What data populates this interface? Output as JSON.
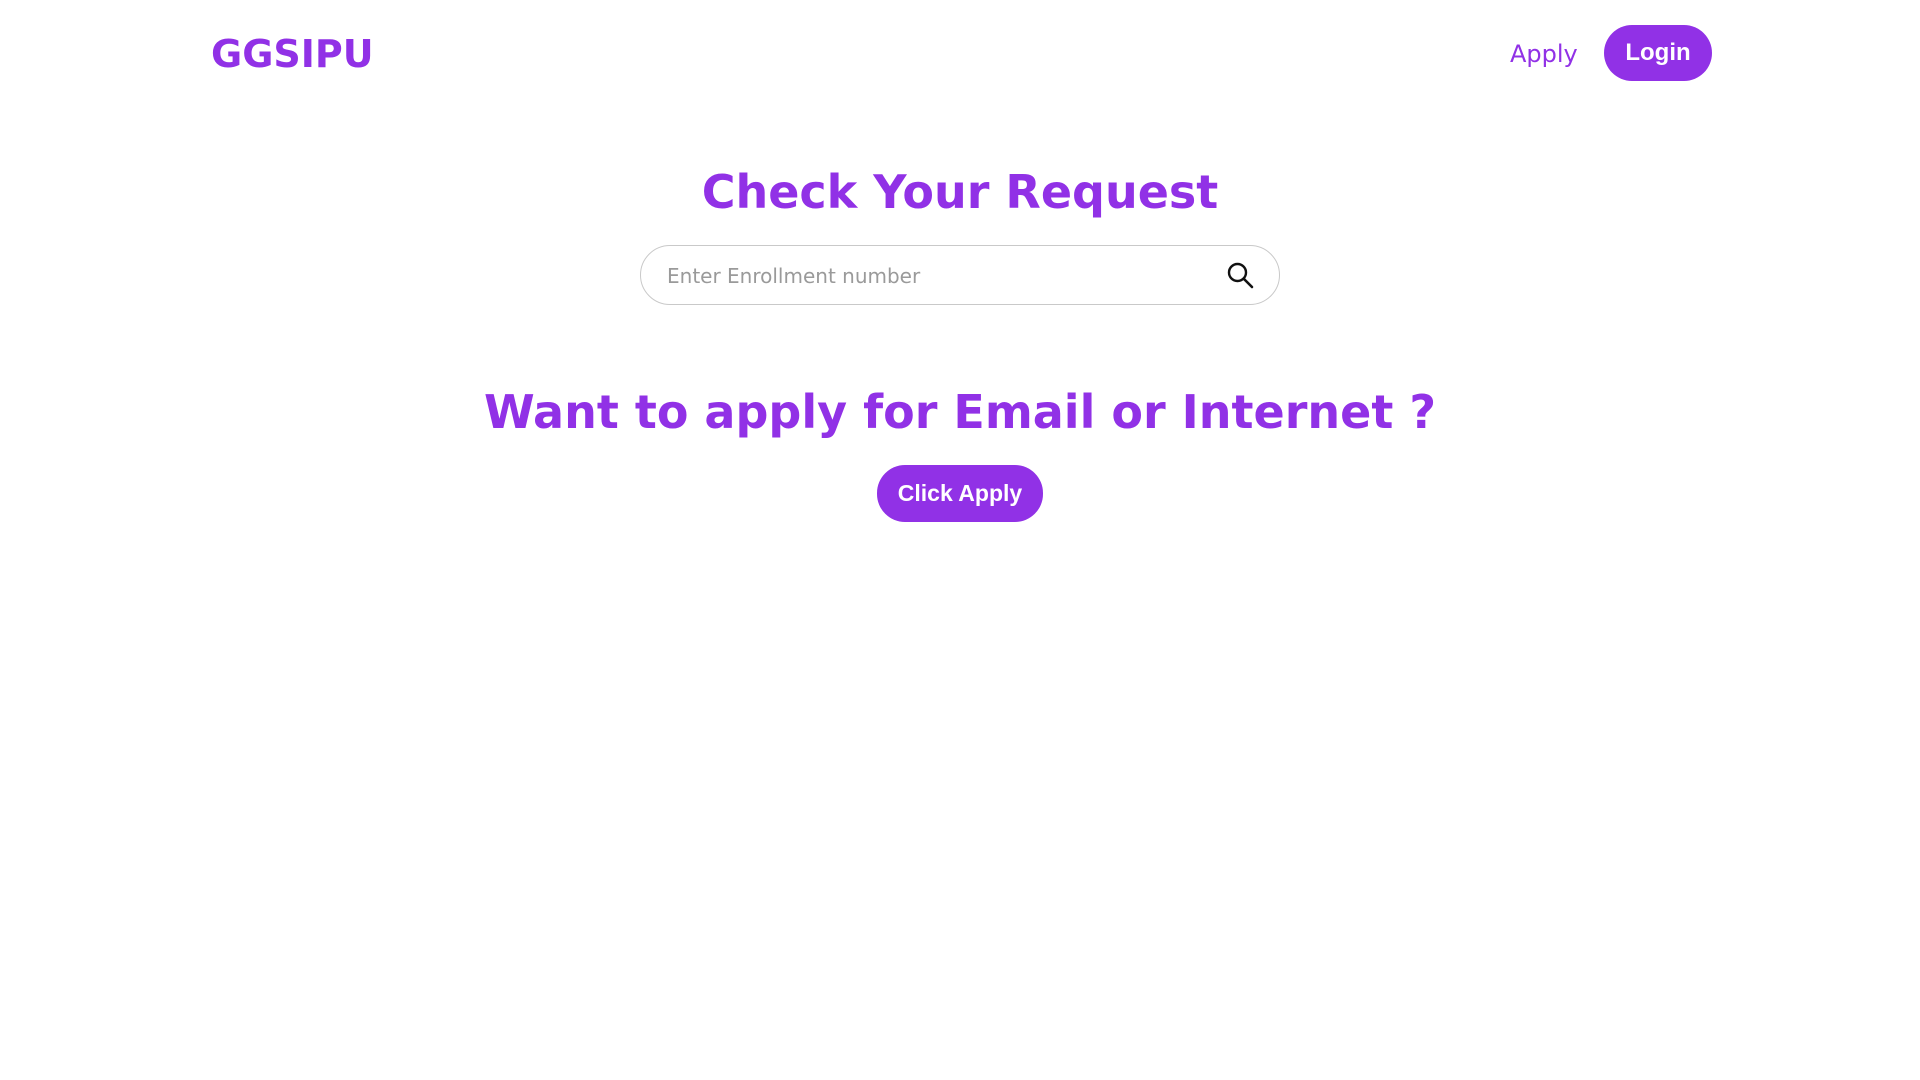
{
  "header": {
    "brand": "GGSIPU",
    "nav_apply": "Apply",
    "login_label": "Login"
  },
  "check": {
    "title": "Check Your Request",
    "search_placeholder": "Enter Enrollment number",
    "search_value": "",
    "search_icon": "search-icon"
  },
  "apply": {
    "title": "Want to apply for Email or Internet ?",
    "button_label": "Click Apply"
  },
  "colors": {
    "accent": "#9131e6",
    "background": "#ffffff",
    "input_border": "#c9c9c9",
    "placeholder": "#9a9a9a"
  }
}
